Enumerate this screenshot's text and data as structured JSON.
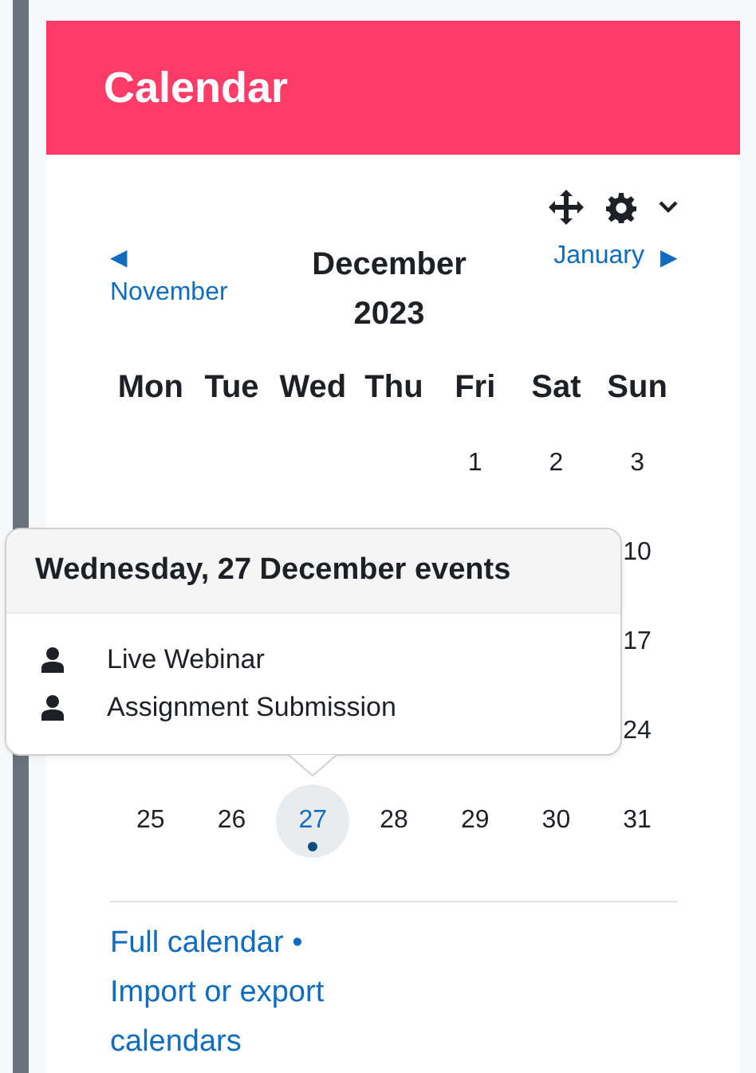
{
  "header": {
    "title": "Calendar"
  },
  "nav": {
    "previous": "November",
    "previous_arrow": "◀",
    "month": "December 2023",
    "next": "January",
    "next_arrow": "▶"
  },
  "weekdays": [
    "Mon",
    "Tue",
    "Wed",
    "Thu",
    "Fri",
    "Sat",
    "Sun"
  ],
  "weeks": [
    [
      {
        "kind": "blank"
      },
      {
        "kind": "blank"
      },
      {
        "kind": "blank"
      },
      {
        "kind": "blank"
      },
      {
        "kind": "day",
        "day": "1",
        "today": false,
        "has_events": false
      },
      {
        "kind": "day",
        "day": "2",
        "today": false,
        "has_events": false
      },
      {
        "kind": "day",
        "day": "3",
        "today": false,
        "has_events": false
      }
    ],
    [
      {
        "kind": "blank"
      },
      {
        "kind": "blank"
      },
      {
        "kind": "blank"
      },
      {
        "kind": "blank"
      },
      {
        "kind": "blank"
      },
      {
        "kind": "blank"
      },
      {
        "kind": "day",
        "day": "10",
        "today": false,
        "has_events": false
      }
    ],
    [
      {
        "kind": "blank"
      },
      {
        "kind": "blank"
      },
      {
        "kind": "blank"
      },
      {
        "kind": "blank"
      },
      {
        "kind": "blank"
      },
      {
        "kind": "blank"
      },
      {
        "kind": "day",
        "day": "17",
        "today": false,
        "has_events": false
      }
    ],
    [
      {
        "kind": "blank"
      },
      {
        "kind": "blank"
      },
      {
        "kind": "blank"
      },
      {
        "kind": "blank"
      },
      {
        "kind": "blank"
      },
      {
        "kind": "blank"
      },
      {
        "kind": "day",
        "day": "24",
        "today": false,
        "has_events": false
      }
    ],
    [
      {
        "kind": "day",
        "day": "25",
        "today": false,
        "has_events": false
      },
      {
        "kind": "day",
        "day": "26",
        "today": false,
        "has_events": false
      },
      {
        "kind": "day",
        "day": "27",
        "today": true,
        "has_events": true
      },
      {
        "kind": "day",
        "day": "28",
        "today": false,
        "has_events": false
      },
      {
        "kind": "day",
        "day": "29",
        "today": false,
        "has_events": false
      },
      {
        "kind": "day",
        "day": "30",
        "today": false,
        "has_events": false
      },
      {
        "kind": "day",
        "day": "31",
        "today": false,
        "has_events": false
      }
    ]
  ],
  "popover": {
    "title": "Wednesday, 27 December events",
    "events": [
      {
        "name": "Live Webinar"
      },
      {
        "name": "Assignment Submission"
      }
    ]
  },
  "footer": {
    "links": [
      "Full calendar",
      "Import or export calendars"
    ],
    "separator": "•"
  }
}
